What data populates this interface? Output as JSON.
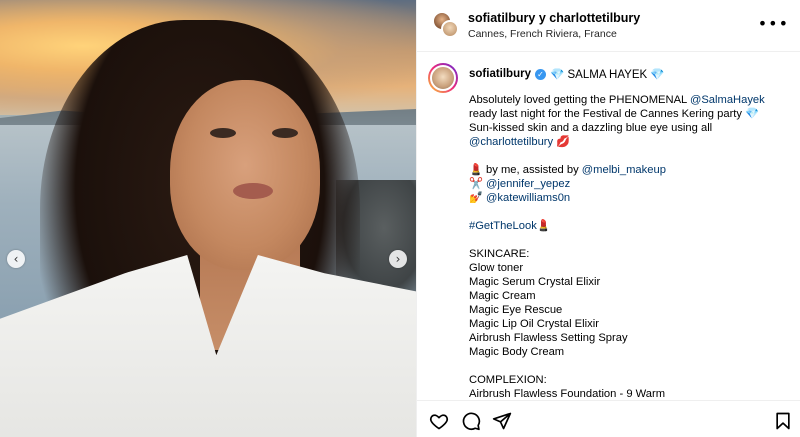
{
  "post": {
    "header": {
      "usernames": "sofiatilbury y charlottetilbury",
      "location": "Cannes, French Riviera, France"
    },
    "caption": {
      "username": "sofiatilbury",
      "mention_emoji_text": "💎 SALMA HAYEK 💎",
      "lines": [
        [
          {
            "t": "Absolutely loved getting the PHENOMENAL "
          },
          {
            "t": "@SalmaHayek",
            "link": true
          }
        ],
        [
          {
            "t": "ready last night for the Festival de Cannes Kering party 💎"
          }
        ],
        [
          {
            "t": "Sun-kissed skin and a dazzling blue eye using all"
          }
        ],
        [
          {
            "t": "@charlottetilbury",
            "link": true
          },
          {
            "t": " 💋"
          }
        ],
        [],
        [
          {
            "t": "💄 by me, assisted by "
          },
          {
            "t": "@melbi_makeup",
            "link": true
          }
        ],
        [
          {
            "t": "✂️ "
          },
          {
            "t": "@jennifer_yepez",
            "link": true
          }
        ],
        [
          {
            "t": "💅 "
          },
          {
            "t": "@katewilliams0n",
            "link": true
          }
        ],
        [],
        [
          {
            "t": "#GetTheLook",
            "link": true
          },
          {
            "t": "💄"
          }
        ],
        [],
        [
          {
            "t": "SKINCARE:"
          }
        ],
        [
          {
            "t": "Glow toner"
          }
        ],
        [
          {
            "t": "Magic Serum Crystal Elixir"
          }
        ],
        [
          {
            "t": "Magic Cream"
          }
        ],
        [
          {
            "t": "Magic Eye Rescue"
          }
        ],
        [
          {
            "t": "Magic Lip Oil Crystal Elixir"
          }
        ],
        [
          {
            "t": "Airbrush Flawless Setting Spray"
          }
        ],
        [
          {
            "t": "Magic Body Cream"
          }
        ],
        [],
        [
          {
            "t": "COMPLEXION:"
          }
        ],
        [
          {
            "t": "Airbrush Flawless Foundation - 9 Warm"
          }
        ]
      ]
    },
    "icons": {
      "prev": "chevron-left-icon",
      "next": "chevron-right-icon",
      "more": "more-options-icon",
      "like": "heart-icon",
      "comment": "comment-icon",
      "share": "share-icon",
      "save": "bookmark-icon"
    },
    "colors": {
      "link": "#00376b",
      "verified": "#3897f0",
      "border": "#efefef"
    }
  }
}
